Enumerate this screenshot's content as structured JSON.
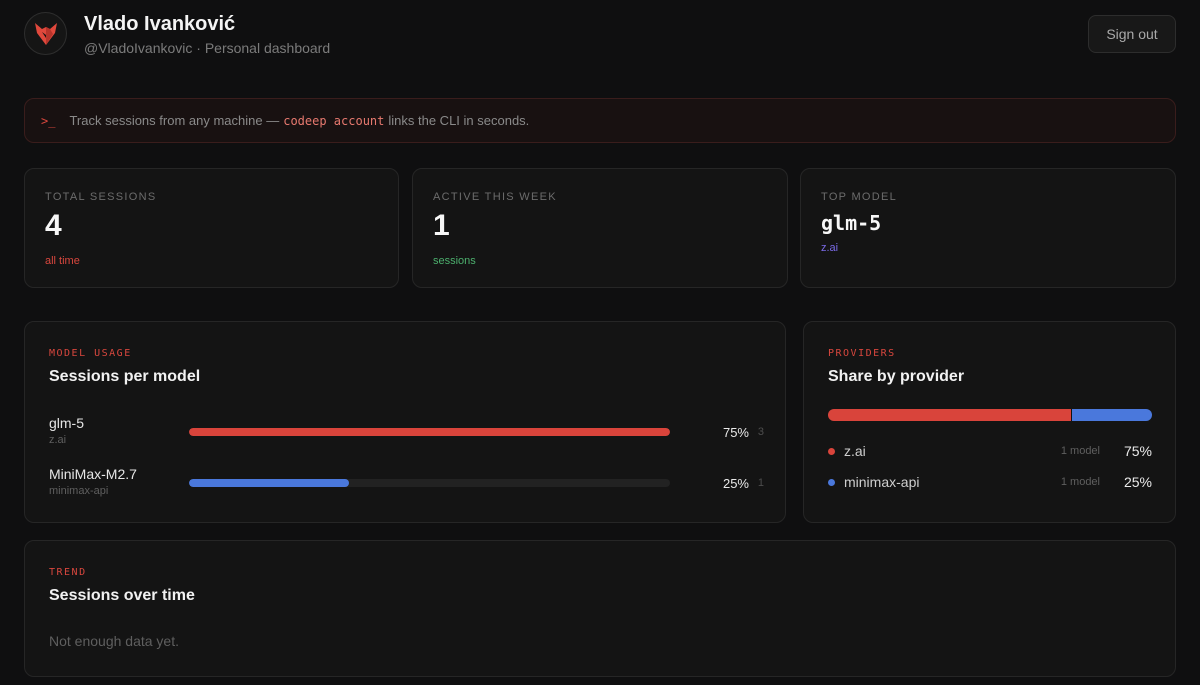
{
  "header": {
    "name": "Vlado Ivanković",
    "subtitle": "@VladoIvankovic · Personal dashboard",
    "logo_icon": "fox-logo-icon",
    "sign_out": "Sign out"
  },
  "banner": {
    "prompt_icon": ">_",
    "text_before": "Track sessions from any machine —",
    "command": "codeep account",
    "text_after": "links the CLI in seconds."
  },
  "stats": [
    {
      "label": "TOTAL SESSIONS",
      "value": "4",
      "sub": "all time",
      "sub_color": "#d9473e"
    },
    {
      "label": "ACTIVE THIS WEEK",
      "value": "1",
      "sub": "sessions",
      "sub_color": "#4caf6d"
    },
    {
      "label": "TOP MODEL",
      "value": "glm-5",
      "sub": "z.ai",
      "sub_color": "#7a6ae6"
    }
  ],
  "model_usage": {
    "label": "MODEL USAGE",
    "title": "Sessions per model",
    "models": [
      {
        "name": "glm-5",
        "provider": "z.ai",
        "percent": "75%",
        "share": 1.0,
        "count": "3",
        "color": "#d9443b"
      },
      {
        "name": "MiniMax-M2.7",
        "provider": "minimax-api",
        "percent": "25%",
        "share": 0.333,
        "count": "1",
        "color": "#4a78dc"
      }
    ]
  },
  "providers": {
    "label": "PROVIDERS",
    "title": "Share by provider",
    "items": [
      {
        "name": "z.ai",
        "models": "1 model",
        "percent": "75%",
        "share": 0.75,
        "color": "#d9443b"
      },
      {
        "name": "minimax-api",
        "models": "1 model",
        "percent": "25%",
        "share": 0.25,
        "color": "#4a78dc"
      }
    ]
  },
  "trend": {
    "label": "TREND",
    "title": "Sessions over time",
    "empty": "Not enough data yet."
  }
}
